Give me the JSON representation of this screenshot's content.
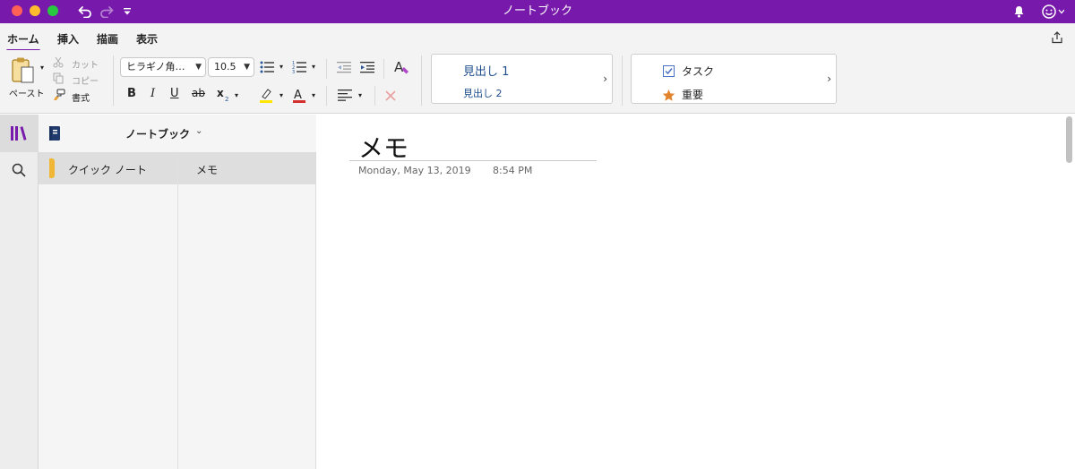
{
  "app": {
    "window_title": "ノートブック"
  },
  "tabs": [
    {
      "label": "ホーム",
      "active": true
    },
    {
      "label": "挿入"
    },
    {
      "label": "描画"
    },
    {
      "label": "表示"
    }
  ],
  "ribbon": {
    "paste_label": "ペースト",
    "cut_label": "カット",
    "copy_label": "コピー",
    "format_painter_label": "書式",
    "font_family": "ヒラギノ角…",
    "font_size": "10.5",
    "bold": "B",
    "italic": "I",
    "underline": "U",
    "strike": "ab",
    "styles": [
      "見出し 1",
      "見出し 2"
    ],
    "tags": [
      "タスク",
      "重要"
    ]
  },
  "notebook": {
    "name": "ノートブック"
  },
  "sections": [
    {
      "label": "クイック ノート",
      "color": "#f2b636"
    }
  ],
  "pages": [
    {
      "label": "メモ"
    }
  ],
  "note": {
    "title": "メモ",
    "date": "Monday, May 13, 2019",
    "time": "8:54 PM"
  },
  "colors": {
    "brand": "#7719aa",
    "notebook_icon": "#1f3a6b",
    "heading_text": "#1e4e8c",
    "highlight": "#ffe600",
    "font_color": "#d32f2f",
    "tag_check": "#4a72c4",
    "tag_star": "#e2832d"
  }
}
